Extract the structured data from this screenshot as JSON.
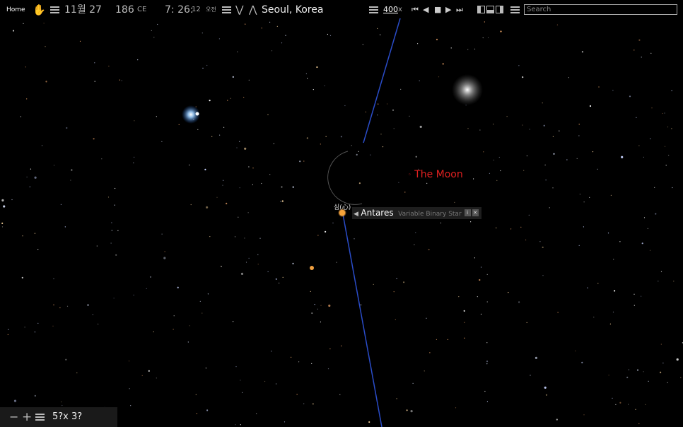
{
  "topbar": {
    "home": "Home",
    "date": "11월 27",
    "year": "186",
    "era": "CE",
    "time": "7: 26:",
    "seconds": "12",
    "ampm": "오전",
    "location": "Seoul, Korea",
    "speed": "400",
    "speed_unit": "x",
    "search_placeholder": "Search"
  },
  "sky": {
    "moon_label": "The Moon",
    "object_name": "Antares",
    "object_type": "Variable Binary Star",
    "korean_label": "심(心)"
  },
  "bottombar": {
    "fov": "5?x 3?"
  },
  "colors": {
    "moon_label": "#e02020",
    "ecliptic_line": "#2a4cc8",
    "antares": "#f0a040"
  }
}
